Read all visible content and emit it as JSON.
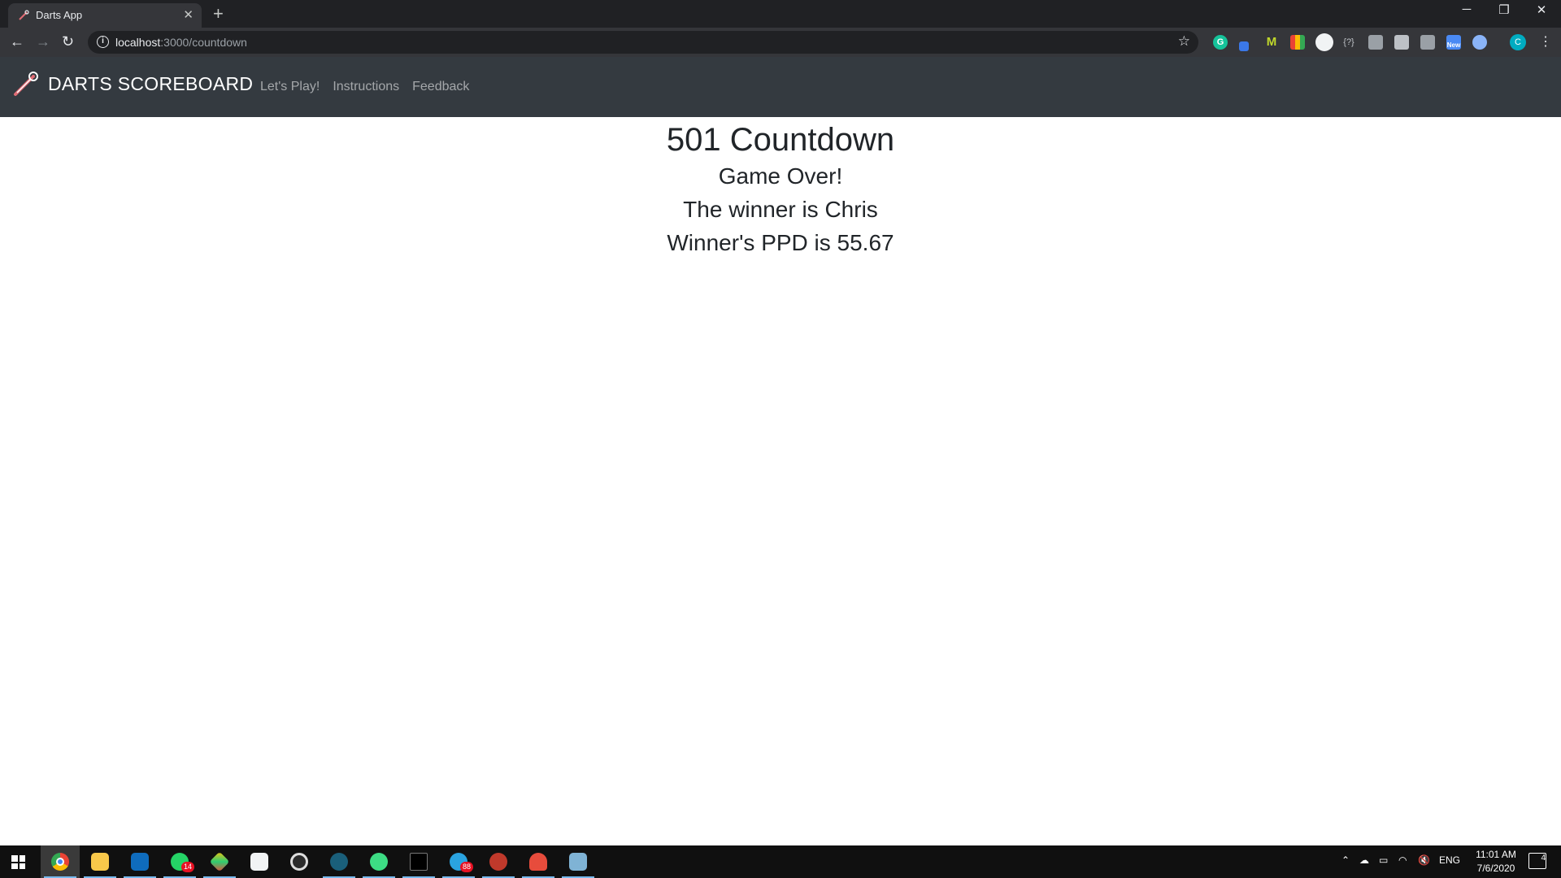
{
  "browser": {
    "tab_title": "Darts App",
    "url_host": "localhost",
    "url_path": ":3000/countdown",
    "extensions": [
      "grammarly-icon",
      "pen-icon",
      "m-icon",
      "color-grid-icon",
      "white-circle-icon",
      "braces-icon",
      "lock-icon",
      "camera-icon",
      "square-icon",
      "new-badge-icon",
      "owl-icon",
      "profile-c-icon"
    ],
    "profile_letter": "C",
    "ext_new_label": "New"
  },
  "navbar": {
    "brand": "DARTS SCOREBOARD",
    "links": [
      "Let's Play!",
      "Instructions",
      "Feedback"
    ]
  },
  "main": {
    "title": "501 Countdown",
    "status": "Game Over!",
    "winner_line": "The winner is Chris",
    "ppd_line": "Winner's PPD is 55.67"
  },
  "taskbar": {
    "apps": [
      "chrome-icon",
      "file-explorer-icon",
      "mail-icon",
      "whatsapp-icon",
      "git-icon",
      "typora-icon",
      "media-icon",
      "app-icon",
      "spotify-icon",
      "terminal-icon",
      "telegram-icon",
      "spider-icon",
      "mushroom-icon",
      "paint-icon"
    ],
    "whatsapp_badge": "14",
    "telegram_badge": "88",
    "language": "ENG",
    "time": "11:01 AM",
    "date": "7/6/2020",
    "notifications": "4"
  }
}
